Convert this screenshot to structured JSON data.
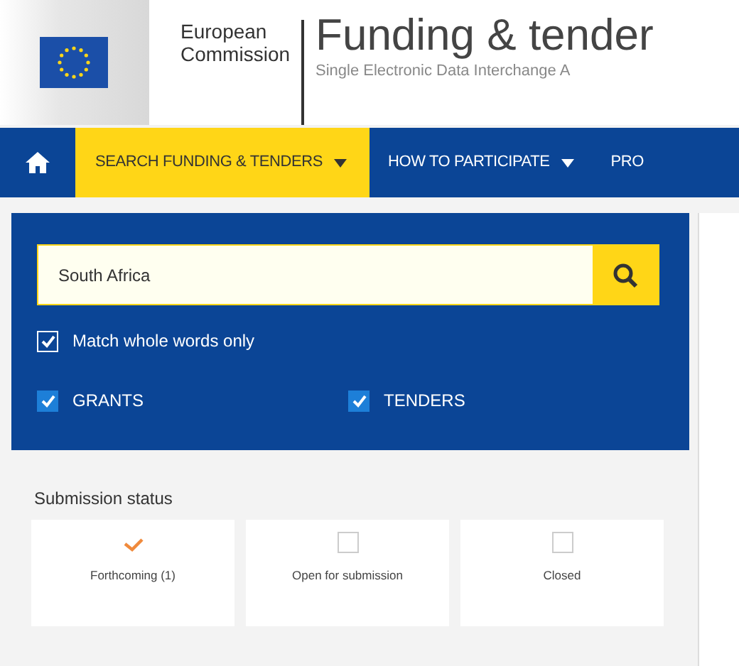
{
  "header": {
    "org_line_1": "European",
    "org_line_2": "Commission",
    "title": "Funding & tender",
    "subtitle": "Single Electronic Data Interchange A"
  },
  "nav": {
    "items": [
      {
        "kind": "home",
        "selected": false
      },
      {
        "kind": "menu",
        "label": "SEARCH FUNDING & TENDERS",
        "selected": true,
        "caret": true
      },
      {
        "kind": "menu",
        "label": "HOW TO PARTICIPATE",
        "selected": false,
        "caret": true
      },
      {
        "kind": "menu",
        "label": "PRO",
        "selected": false,
        "caret": false
      }
    ]
  },
  "search": {
    "value": "South Africa",
    "match_whole_words": {
      "label": "Match whole words only",
      "checked": true
    },
    "types": [
      {
        "label": "GRANTS",
        "checked": true
      },
      {
        "label": "TENDERS",
        "checked": true
      }
    ]
  },
  "submission_status": {
    "title": "Submission status",
    "options": [
      {
        "label": "Forthcoming (1)",
        "checked": true
      },
      {
        "label": "Open for submission",
        "checked": false
      },
      {
        "label": "Closed",
        "checked": false
      }
    ]
  }
}
